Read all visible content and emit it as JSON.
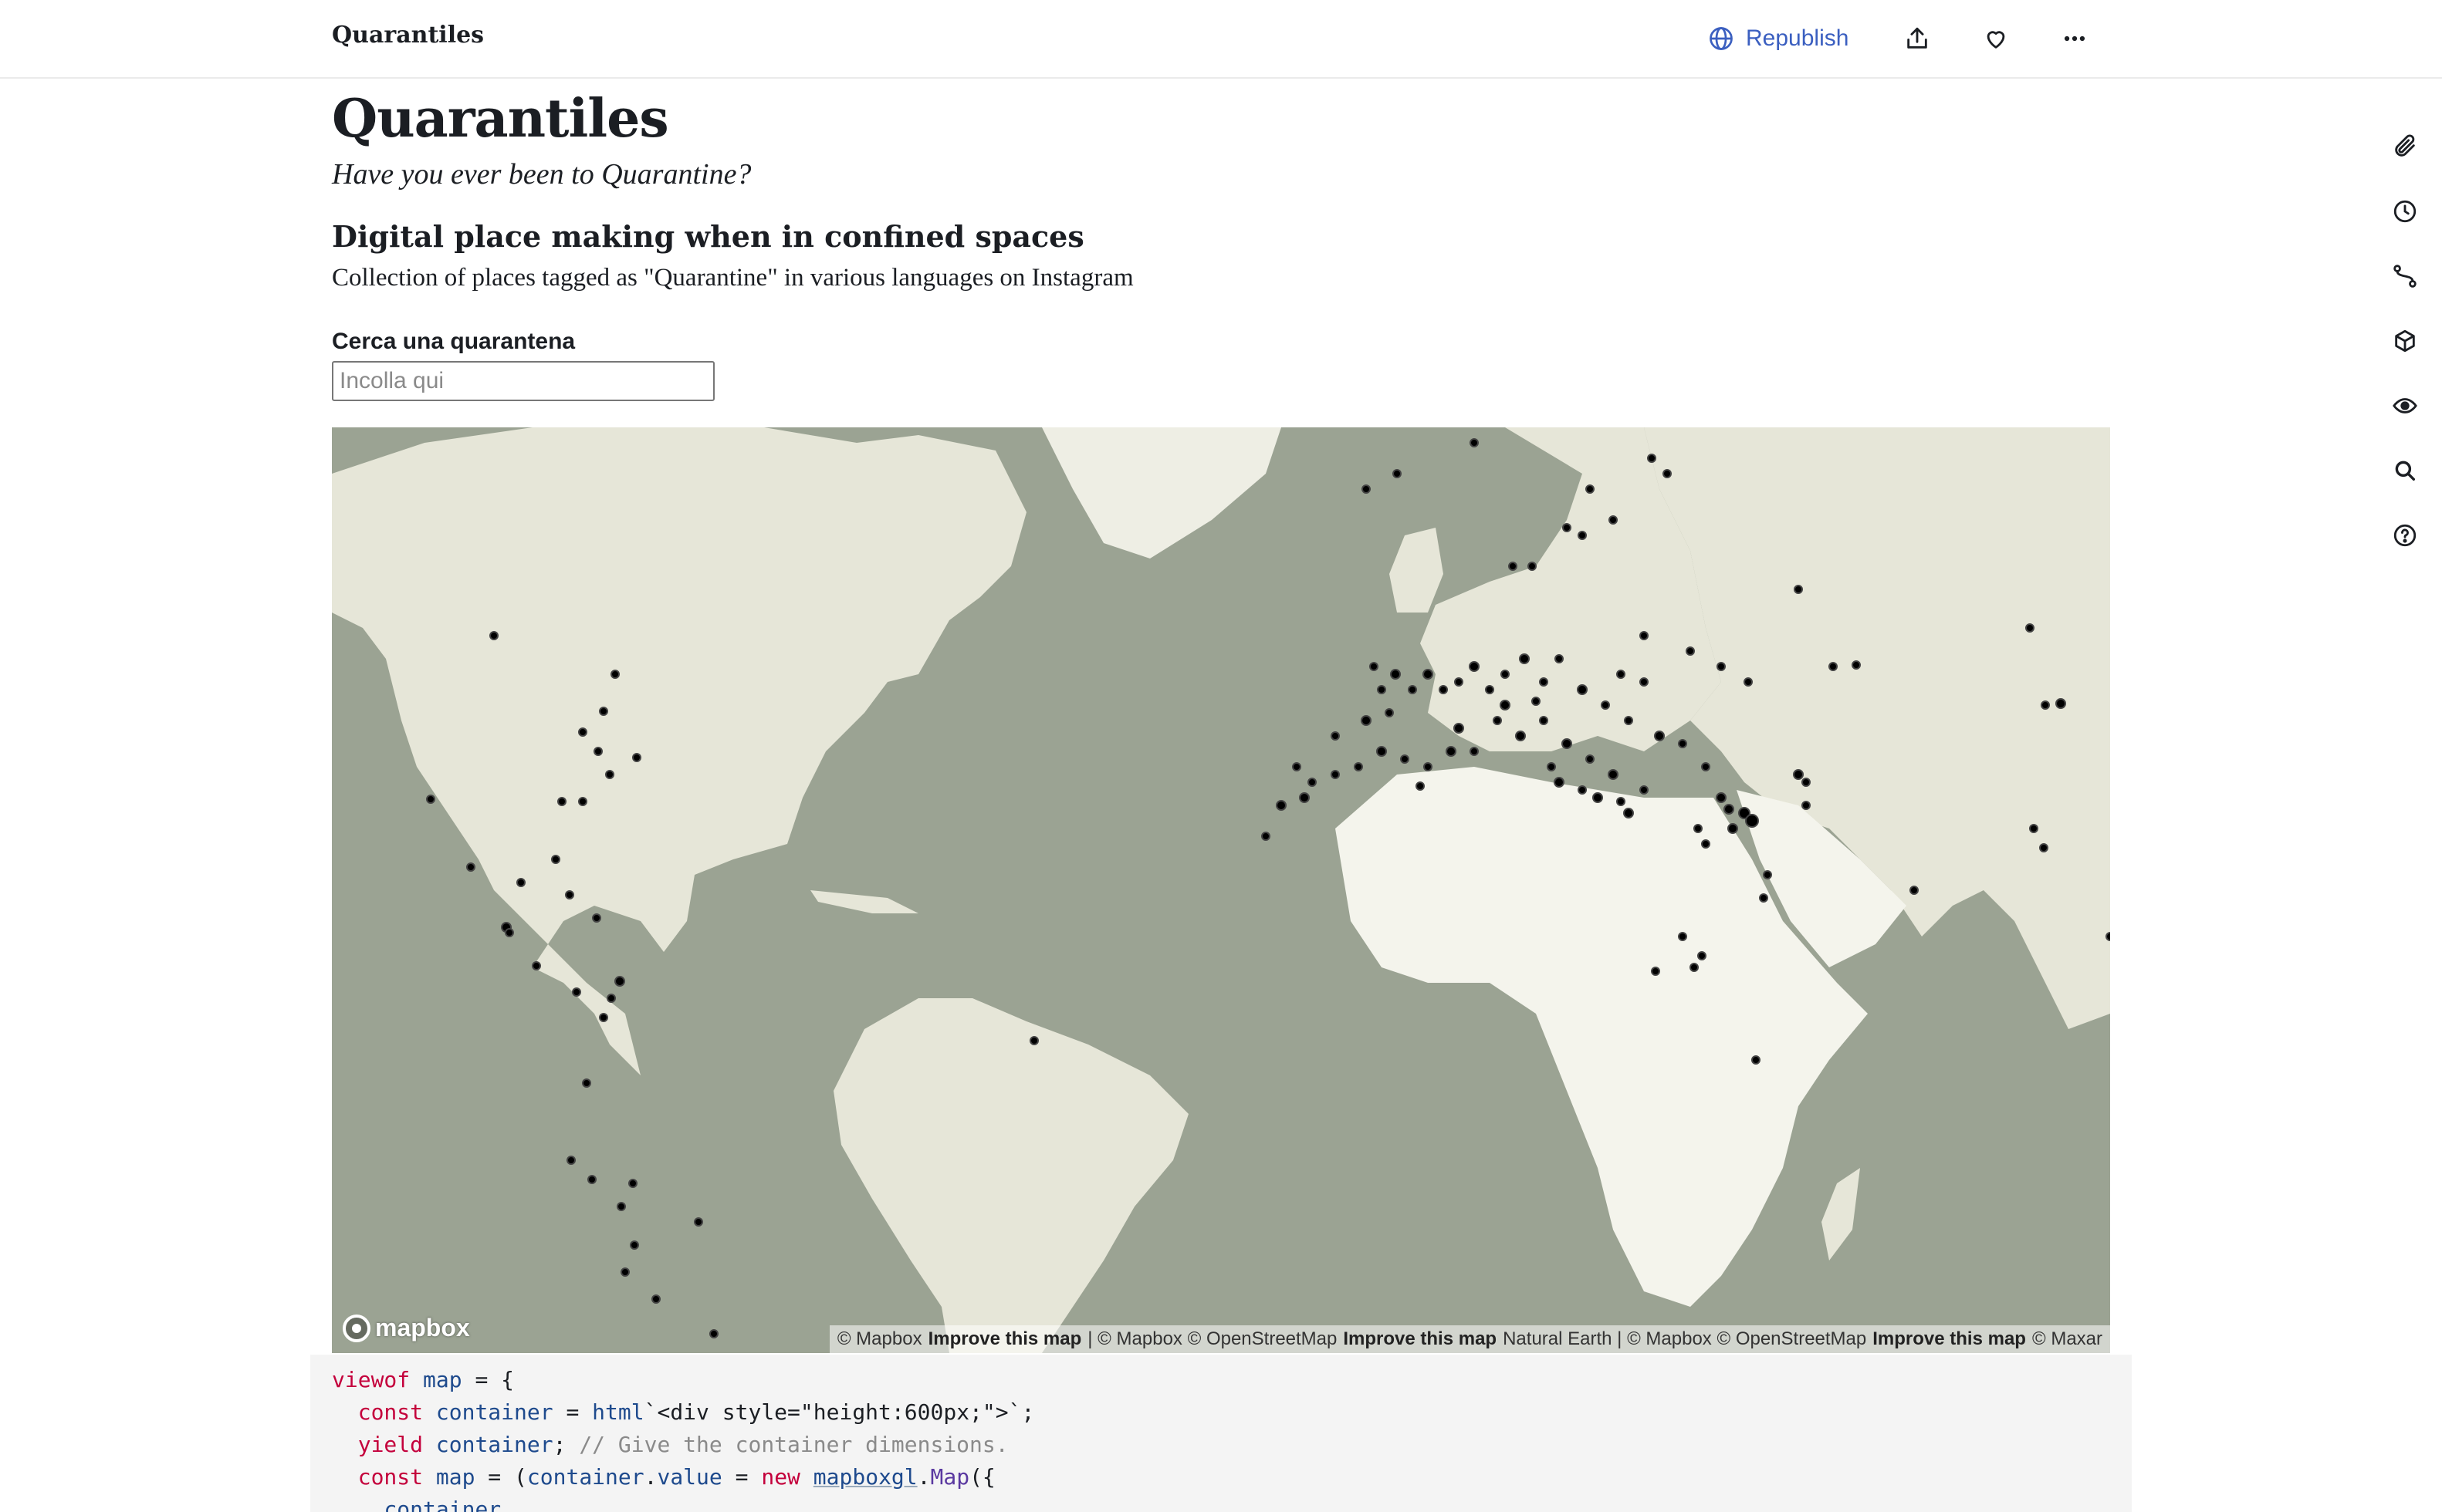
{
  "topbar": {
    "brand": "Quarantiles",
    "republish_label": "Republish"
  },
  "page": {
    "title": "Quarantiles",
    "subtitle": "Have you ever been to Quarantine?",
    "heading": "Digital place making when in confined spaces",
    "description": "Collection of places tagged as \"Quarantine\" in various languages on Instagram"
  },
  "search": {
    "label": "Cerca una quarantena",
    "placeholder": "Incolla qui"
  },
  "map": {
    "logo_text": "mapbox",
    "attribution": {
      "a1": "© Mapbox",
      "l1": "Improve this map",
      "a2": "| © Mapbox © OpenStreetMap",
      "l2": "Improve this map",
      "a3": "Natural Earth | © Mapbox © OpenStreetMap",
      "l3": "Improve this map",
      "a4": "© Maxar"
    },
    "colors": {
      "water": "#9ba393",
      "land": "#e6e6d8",
      "land_light": "#f4f4ec",
      "point": "#000000"
    }
  },
  "code": {
    "line1": {
      "kw": "viewof",
      "name": "map",
      "rest": " = {"
    },
    "line2": {
      "kw": "const",
      "name": "container",
      "op": " = ",
      "fn": "html",
      "rest": "`<div style=\"height:600px;\">`;"
    },
    "line3": {
      "kw": "yield",
      "name": "container",
      "rest": "; ",
      "comment": "// Give the container dimensions."
    },
    "line4": {
      "kw": "const",
      "name": "map",
      "op": " = (",
      "name2": "container",
      "dot": ".",
      "prop": "value",
      "op2": " = ",
      "kw2": "new",
      "lib": "mapboxgl",
      "dot2": ".",
      "cls": "Map",
      "rest": "({"
    },
    "line5": {
      "name": "container",
      "rest": ","
    }
  }
}
